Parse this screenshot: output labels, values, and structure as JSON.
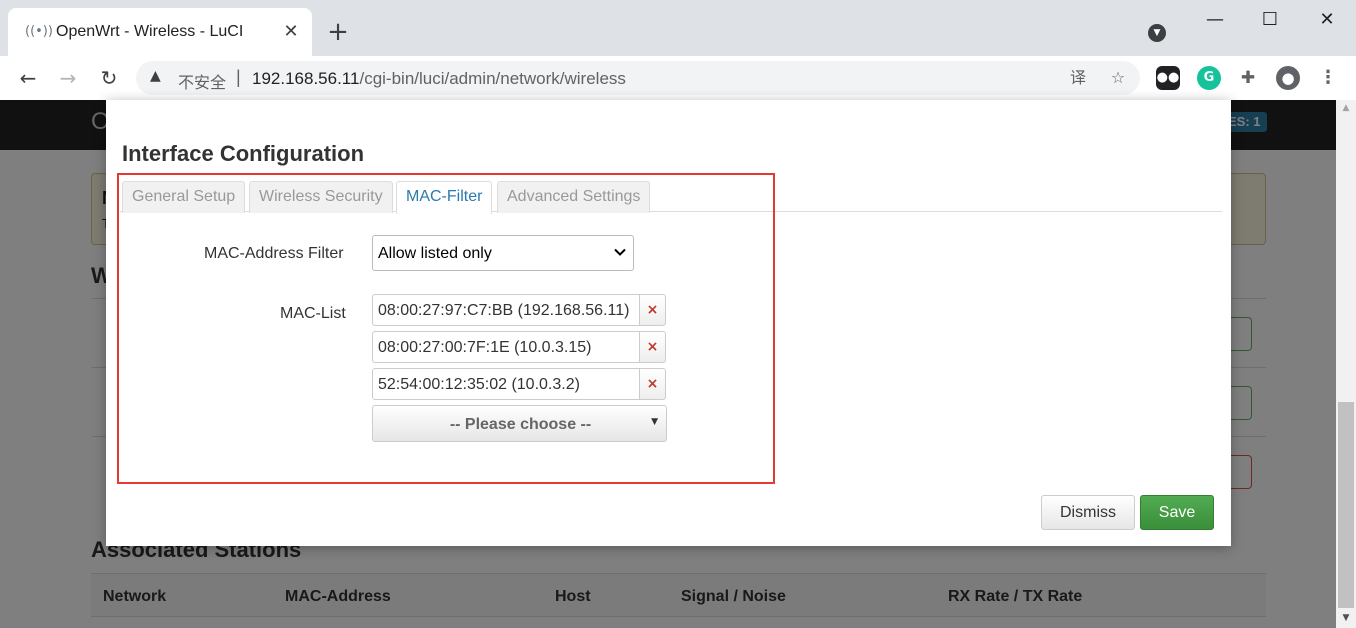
{
  "browser": {
    "tab_title": "OpenWrt - Wireless - LuCI",
    "favicon": "wireless-signal-icon",
    "new_tab": "+",
    "close_tab": "✕",
    "window_controls": {
      "minimize": "—",
      "maximize": "☐",
      "close": "✕"
    },
    "nav": {
      "back": "←",
      "forward": "→",
      "reload": "↻"
    },
    "insecure_label": "不安全",
    "url_host": "192.168.56.11",
    "url_path": "/cgi-bin/luci/admin/network/wireless",
    "icons": [
      "translate-icon",
      "star-icon",
      "extension-icon",
      "grammarly-icon",
      "puzzle-icon",
      "profile-icon",
      "menu-icon"
    ]
  },
  "background_page": {
    "brand": "O",
    "badge": "ES: 1",
    "alert_title": "N",
    "alert_text": "T",
    "heading": "W",
    "assoc_heading": "Associated Stations",
    "assoc_columns": [
      "Network",
      "MAC-Address",
      "Host",
      "Signal / Noise",
      "RX Rate / TX Rate"
    ]
  },
  "modal": {
    "title": "Interface Configuration",
    "tabs": [
      {
        "label": "General Setup",
        "active": false
      },
      {
        "label": "Wireless Security",
        "active": false
      },
      {
        "label": "MAC-Filter",
        "active": true
      },
      {
        "label": "Advanced Settings",
        "active": false
      }
    ],
    "mac_filter": {
      "label": "MAC-Address Filter",
      "value": "Allow listed only"
    },
    "mac_list": {
      "label": "MAC-List",
      "entries": [
        "08:00:27:97:C7:BB (192.168.56.11)",
        "08:00:27:00:7F:1E (10.0.3.15)",
        "52:54:00:12:35:02 (10.0.3.2)"
      ],
      "remove_symbol": "×",
      "choose_placeholder": "-- Please choose --"
    },
    "buttons": {
      "dismiss": "Dismiss",
      "save": "Save"
    }
  },
  "colors": {
    "accent_tab": "#2a7ab0",
    "save_button": "#42a142",
    "remove_icon": "#c0392b",
    "highlight": "#e53935"
  }
}
